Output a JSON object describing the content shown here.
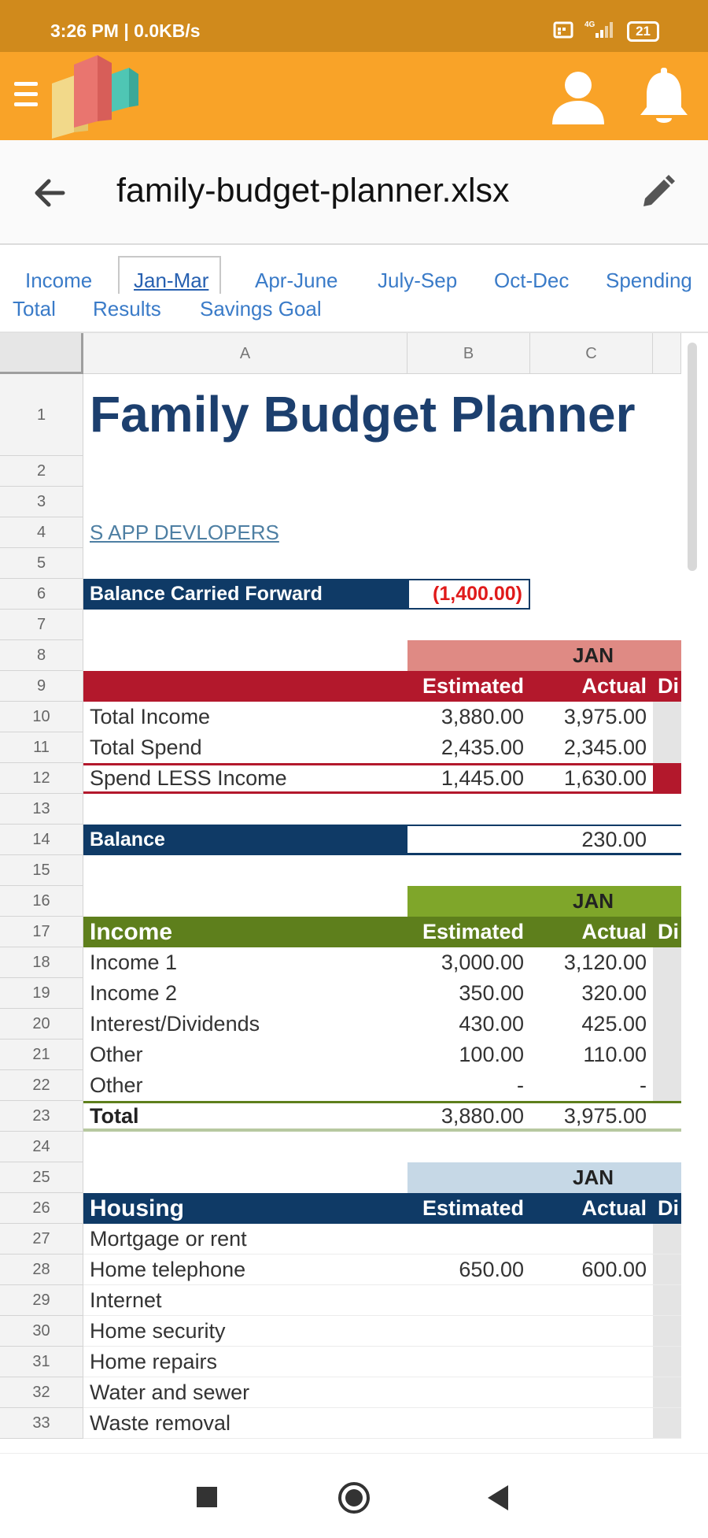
{
  "status_bar": {
    "time": "3:26 PM | 0.0KB/s",
    "network": "4G",
    "battery": "21"
  },
  "app": {
    "menu_icon": "hamburger-menu-icon",
    "logo": "app-logo",
    "user_icon": "user-icon",
    "bell_icon": "bell-icon"
  },
  "file": {
    "name": "family-budget-planner.xlsx",
    "back_icon": "back-arrow-icon",
    "edit_icon": "pencil-edit-icon"
  },
  "tabs": {
    "income": "Income",
    "jan_mar": "Jan-Mar",
    "apr_june": "Apr-June",
    "july_sep": "July-Sep",
    "oct_dec": "Oct-Dec",
    "spending": "Spending",
    "total": "Total",
    "results": "Results",
    "savings_goal": "Savings Goal",
    "active": "Jan-Mar"
  },
  "columns": {
    "a": "A",
    "b": "B",
    "c": "C"
  },
  "rows": [
    "1",
    "2",
    "3",
    "4",
    "5",
    "6",
    "7",
    "8",
    "9",
    "10",
    "11",
    "12",
    "13",
    "14",
    "15",
    "16",
    "17",
    "18",
    "19",
    "20",
    "21",
    "22",
    "23",
    "24",
    "25",
    "26",
    "27",
    "28",
    "29",
    "30",
    "31",
    "32",
    "33"
  ],
  "sheet": {
    "title": "Family Budget Planner",
    "developer_link": "S APP DEVLOPERS",
    "balance_forward_label": "Balance Carried Forward",
    "balance_forward_value": "(1,400.00)",
    "summary": {
      "month": "JAN",
      "col_estimated": "Estimated",
      "col_actual": "Actual",
      "col_diff": "Di",
      "total_income": {
        "label": "Total Income",
        "estimated": "3,880.00",
        "actual": "3,975.00"
      },
      "total_spend": {
        "label": "Total Spend",
        "estimated": "2,435.00",
        "actual": "2,345.00"
      },
      "spend_less_income": {
        "label": "Spend LESS Income",
        "estimated": "1,445.00",
        "actual": "1,630.00"
      },
      "balance_label": "Balance",
      "balance_value": "230.00"
    },
    "income": {
      "month": "JAN",
      "header": "Income",
      "col_estimated": "Estimated",
      "col_actual": "Actual",
      "col_diff": "Di",
      "items": [
        {
          "label": "Income 1",
          "estimated": "3,000.00",
          "actual": "3,120.00"
        },
        {
          "label": "Income 2",
          "estimated": "350.00",
          "actual": "320.00"
        },
        {
          "label": "Interest/Dividends",
          "estimated": "430.00",
          "actual": "425.00"
        },
        {
          "label": "Other",
          "estimated": "100.00",
          "actual": "110.00"
        },
        {
          "label": "Other",
          "estimated": "-",
          "actual": "-"
        }
      ],
      "total": {
        "label": "Total",
        "estimated": "3,880.00",
        "actual": "3,975.00"
      }
    },
    "housing": {
      "month": "JAN",
      "header": "Housing",
      "col_estimated": "Estimated",
      "col_actual": "Actual",
      "col_diff": "Di",
      "items": [
        {
          "label": "Mortgage or rent",
          "estimated": "",
          "actual": ""
        },
        {
          "label": "Home telephone",
          "estimated": "650.00",
          "actual": "600.00"
        },
        {
          "label": "Internet",
          "estimated": "",
          "actual": ""
        },
        {
          "label": "Home security",
          "estimated": "",
          "actual": ""
        },
        {
          "label": "Home repairs",
          "estimated": "",
          "actual": ""
        },
        {
          "label": "Water and sewer",
          "estimated": "",
          "actual": ""
        },
        {
          "label": "Waste removal",
          "estimated": "",
          "actual": ""
        }
      ]
    }
  },
  "colors": {
    "status_bar": "#d08a1c",
    "app_bar": "#f9a328",
    "navy": "#0f3a66",
    "crimson": "#b3182c",
    "salmon": "#df8a84",
    "olive": "#5e7f1c",
    "lime": "#7fa62a",
    "light_blue": "#c6d8e6",
    "negative_red": "#e01a1a"
  },
  "nav": {
    "recents": "recents-square-icon",
    "home": "home-circle-icon",
    "back": "back-triangle-icon"
  }
}
